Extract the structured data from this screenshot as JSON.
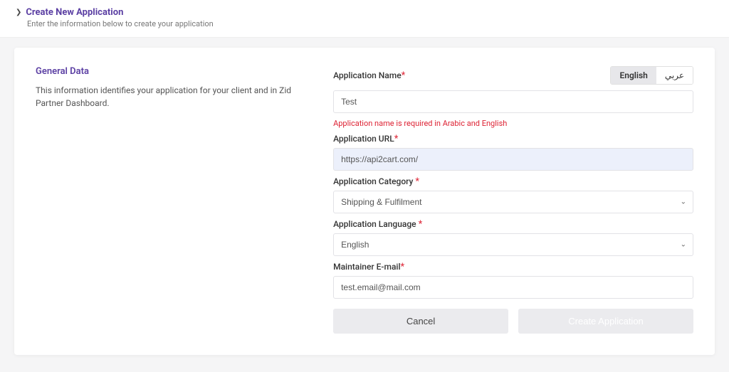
{
  "header": {
    "title": "Create New Application",
    "subtitle": "Enter the information below to create your application"
  },
  "section": {
    "title": "General Data",
    "description": "This information identifies your application for your client and in Zid Partner Dashboard."
  },
  "langTabs": {
    "en": "English",
    "ar": "عربي"
  },
  "labels": {
    "app_name": "Application Name",
    "app_url": "Application URL",
    "app_category": "Application Category ",
    "app_language": "Application Language ",
    "maintainer_email": "Maintainer E-mail",
    "required": "*"
  },
  "values": {
    "app_name": "Test",
    "app_url": "https://api2cart.com/",
    "app_category": "Shipping & Fulfilment",
    "app_language": "English",
    "maintainer_email": "test.email@mail.com"
  },
  "errors": {
    "app_name": "Application name is required in Arabic and English"
  },
  "buttons": {
    "cancel": "Cancel",
    "create": "Create Application"
  }
}
